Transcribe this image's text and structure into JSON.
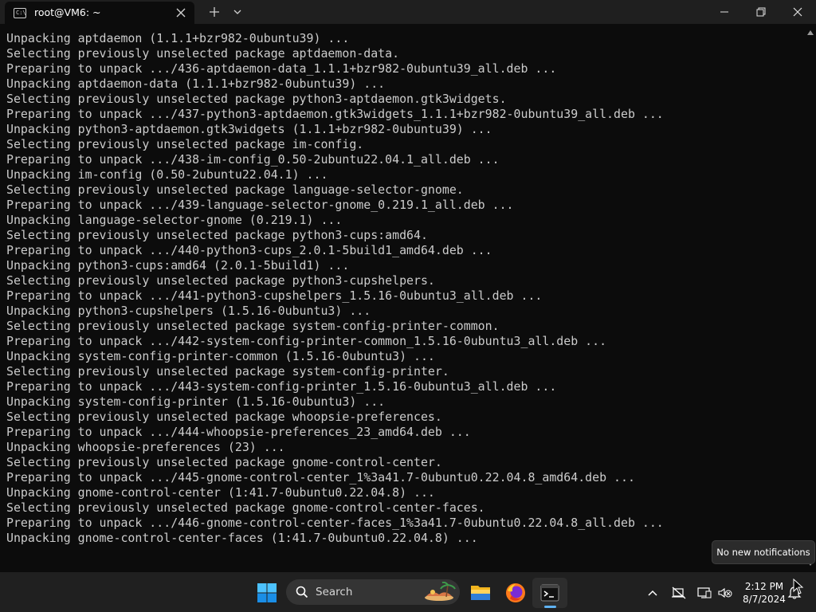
{
  "window": {
    "tab_title": "root@VM6: ~",
    "tab_icon_text": "C:\\"
  },
  "terminal": {
    "lines": [
      "Unpacking aptdaemon (1.1.1+bzr982-0ubuntu39) ...",
      "Selecting previously unselected package aptdaemon-data.",
      "Preparing to unpack .../436-aptdaemon-data_1.1.1+bzr982-0ubuntu39_all.deb ...",
      "Unpacking aptdaemon-data (1.1.1+bzr982-0ubuntu39) ...",
      "Selecting previously unselected package python3-aptdaemon.gtk3widgets.",
      "Preparing to unpack .../437-python3-aptdaemon.gtk3widgets_1.1.1+bzr982-0ubuntu39_all.deb ...",
      "Unpacking python3-aptdaemon.gtk3widgets (1.1.1+bzr982-0ubuntu39) ...",
      "Selecting previously unselected package im-config.",
      "Preparing to unpack .../438-im-config_0.50-2ubuntu22.04.1_all.deb ...",
      "Unpacking im-config (0.50-2ubuntu22.04.1) ...",
      "Selecting previously unselected package language-selector-gnome.",
      "Preparing to unpack .../439-language-selector-gnome_0.219.1_all.deb ...",
      "Unpacking language-selector-gnome (0.219.1) ...",
      "Selecting previously unselected package python3-cups:amd64.",
      "Preparing to unpack .../440-python3-cups_2.0.1-5build1_amd64.deb ...",
      "Unpacking python3-cups:amd64 (2.0.1-5build1) ...",
      "Selecting previously unselected package python3-cupshelpers.",
      "Preparing to unpack .../441-python3-cupshelpers_1.5.16-0ubuntu3_all.deb ...",
      "Unpacking python3-cupshelpers (1.5.16-0ubuntu3) ...",
      "Selecting previously unselected package system-config-printer-common.",
      "Preparing to unpack .../442-system-config-printer-common_1.5.16-0ubuntu3_all.deb ...",
      "Unpacking system-config-printer-common (1.5.16-0ubuntu3) ...",
      "Selecting previously unselected package system-config-printer.",
      "Preparing to unpack .../443-system-config-printer_1.5.16-0ubuntu3_all.deb ...",
      "Unpacking system-config-printer (1.5.16-0ubuntu3) ...",
      "Selecting previously unselected package whoopsie-preferences.",
      "Preparing to unpack .../444-whoopsie-preferences_23_amd64.deb ...",
      "Unpacking whoopsie-preferences (23) ...",
      "Selecting previously unselected package gnome-control-center.",
      "Preparing to unpack .../445-gnome-control-center_1%3a41.7-0ubuntu0.22.04.8_amd64.deb ...",
      "Unpacking gnome-control-center (1:41.7-0ubuntu0.22.04.8) ...",
      "Selecting previously unselected package gnome-control-center-faces.",
      "Preparing to unpack .../446-gnome-control-center-faces_1%3a41.7-0ubuntu0.22.04.8_all.deb ...",
      "Unpacking gnome-control-center-faces (1:41.7-0ubuntu0.22.04.8) ..."
    ]
  },
  "taskbar": {
    "search_label": "Search",
    "time": "2:12 PM",
    "date": "8/7/2024",
    "accent_color": "#5fb2f2"
  },
  "tooltip": {
    "text": "No new notifications"
  }
}
